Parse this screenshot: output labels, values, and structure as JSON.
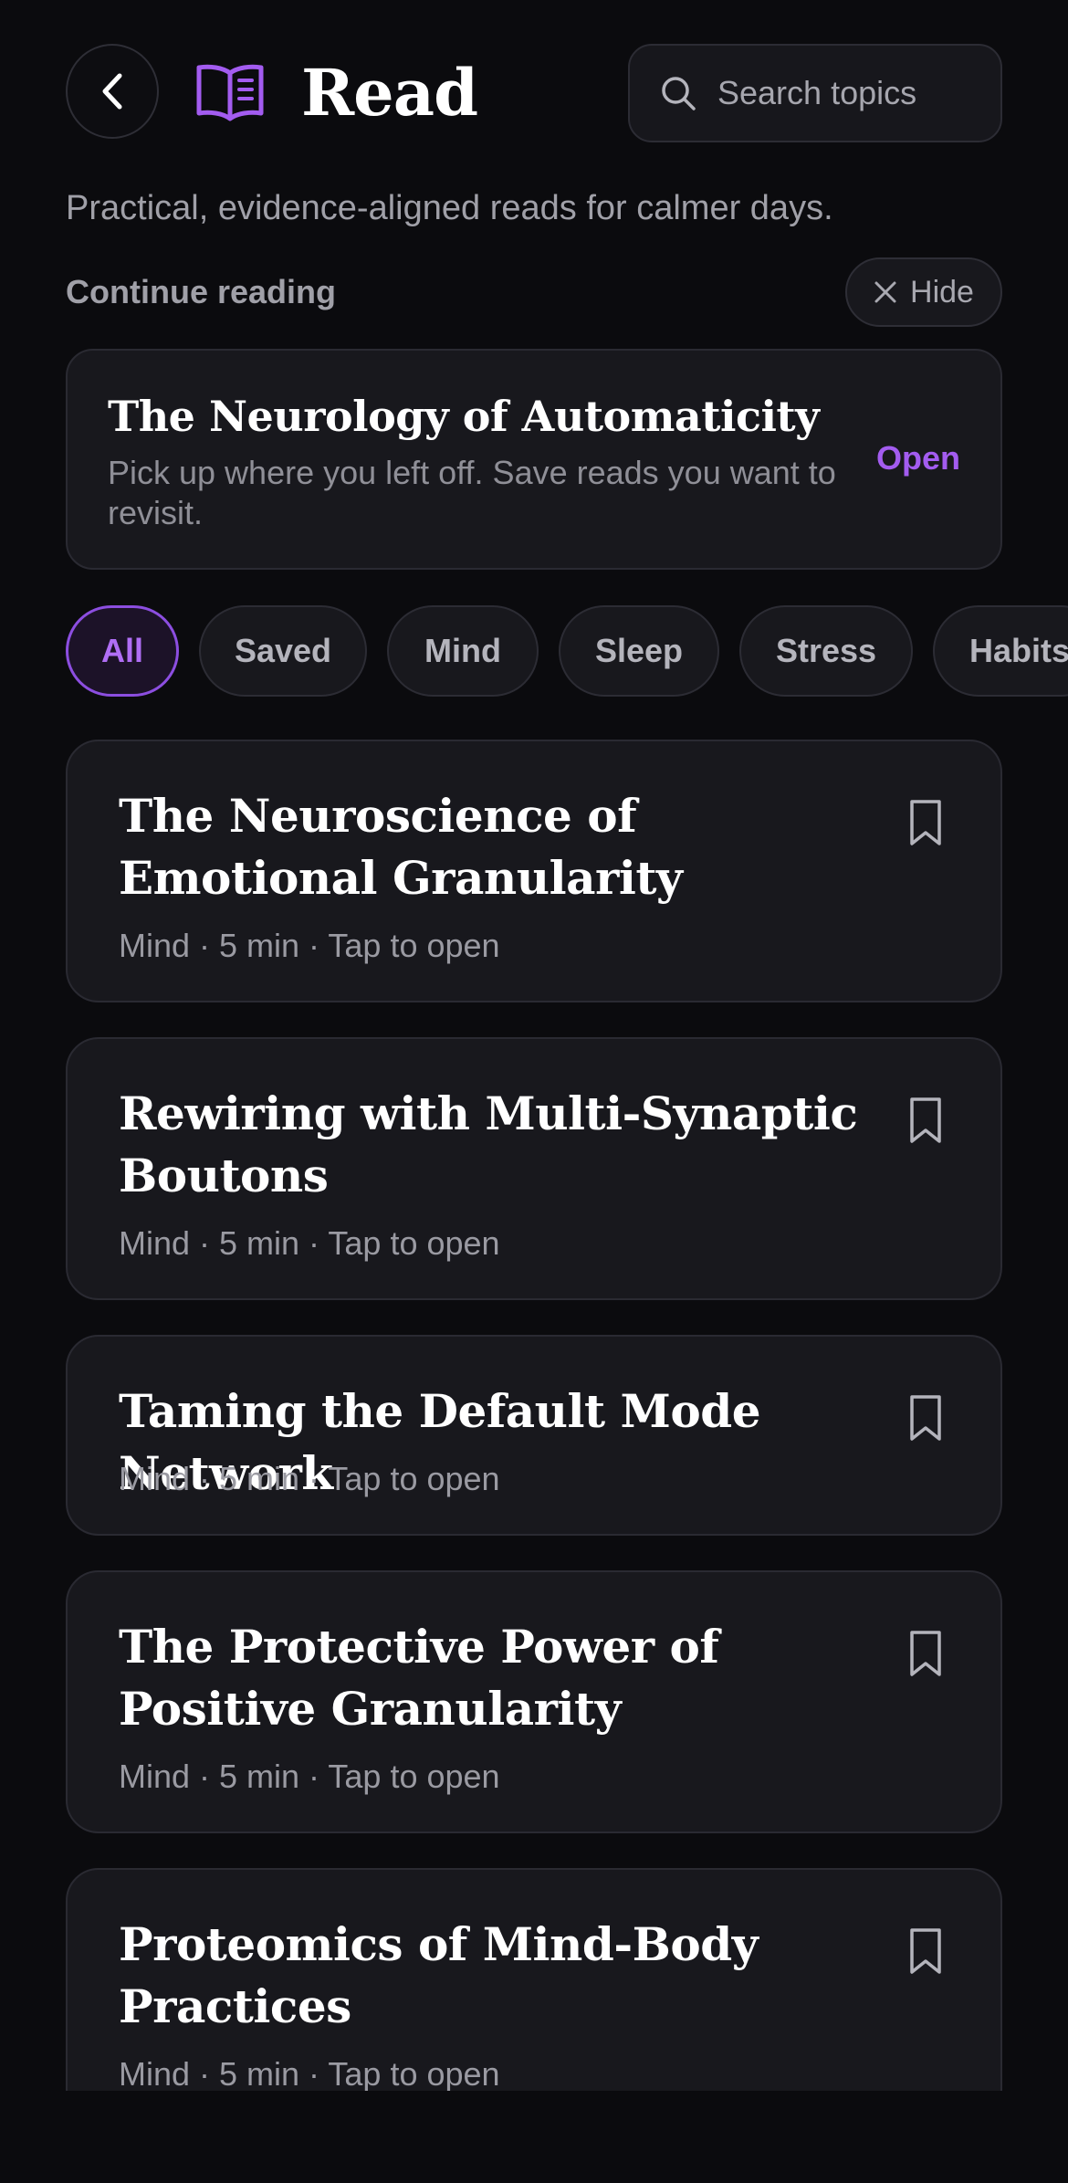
{
  "header": {
    "title": "Read",
    "search_placeholder": "Search topics"
  },
  "subtitle": "Practical, evidence-aligned reads for calmer days.",
  "continue": {
    "label": "Continue reading",
    "hide_label": "Hide",
    "title": "The Neurology of Automaticity",
    "description": "Pick up where you left off. Save reads you want to revisit.",
    "open_label": "Open"
  },
  "filters": [
    {
      "label": "All",
      "active": true
    },
    {
      "label": "Saved",
      "active": false
    },
    {
      "label": "Mind",
      "active": false
    },
    {
      "label": "Sleep",
      "active": false
    },
    {
      "label": "Stress",
      "active": false
    },
    {
      "label": "Habits",
      "active": false
    }
  ],
  "articles": [
    {
      "title": "The Neuroscience of Emotional Granularity",
      "meta": "Mind · 5 min · Tap to open"
    },
    {
      "title": "Rewiring with Multi-Synaptic Boutons",
      "meta": "Mind · 5 min · Tap to open"
    },
    {
      "title": "Taming the Default Mode Network",
      "meta": "Mind · 5 min · Tap to open"
    },
    {
      "title": "The Protective Power of Positive Granularity",
      "meta": "Mind · 5 min · Tap to open"
    },
    {
      "title": "Proteomics of Mind-Body Practices",
      "meta": "Mind · 5 min · Tap to open"
    }
  ],
  "colors": {
    "accent": "#a35cf0",
    "background": "#0b0b0e",
    "card": "#18181d"
  }
}
